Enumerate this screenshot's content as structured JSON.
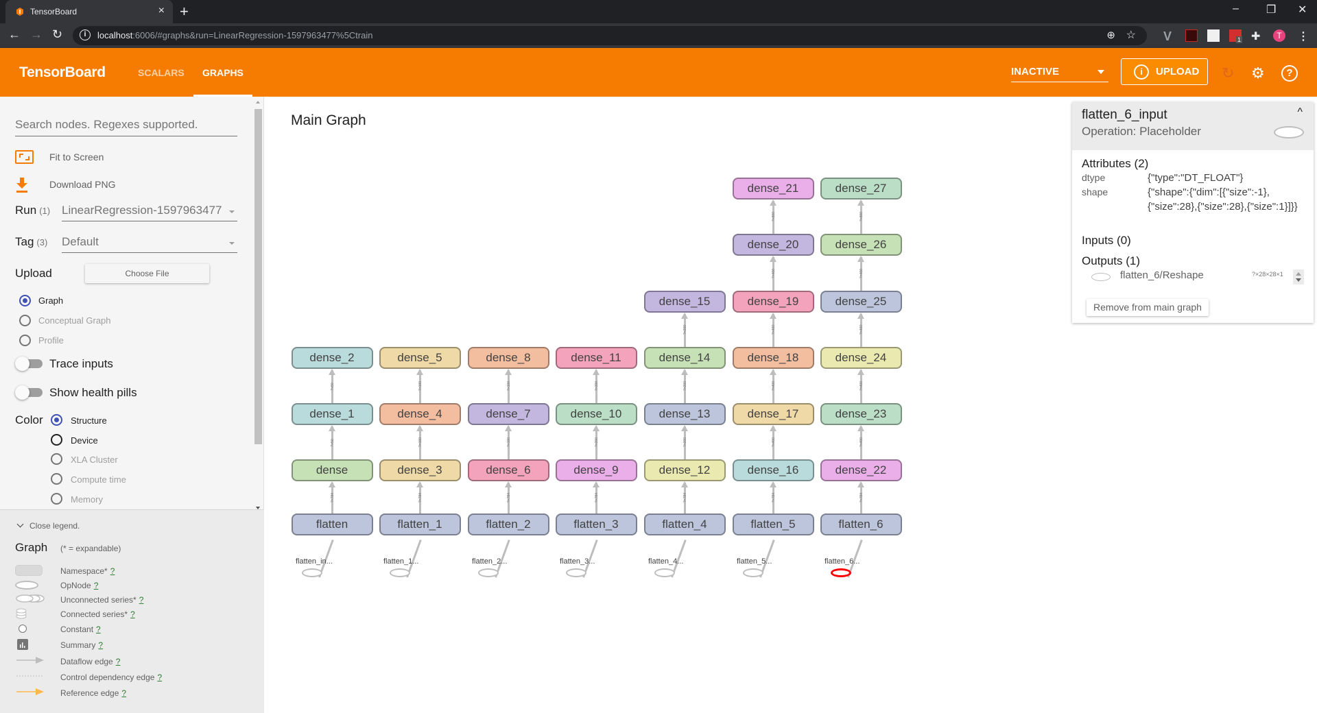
{
  "browser": {
    "tab_title": "TensorBoard",
    "tab_close": "×",
    "new_tab": "+",
    "url_host": "localhost",
    "url_rest": ":6006/#graphs&run=LinearRegression-1597963477%5Ctrain",
    "window_controls": {
      "minimize": "–",
      "restore": "❐",
      "close": "✕"
    },
    "profile_initial": "T",
    "extension_badge": "1"
  },
  "header": {
    "brand": "TensorBoard",
    "tabs": [
      {
        "label": "SCALARS",
        "active": false
      },
      {
        "label": "GRAPHS",
        "active": true
      }
    ],
    "status_select": "INACTIVE",
    "upload_label": "UPLOAD",
    "accent_color": "#f57c00"
  },
  "sidebar": {
    "search_placeholder": "Search nodes. Regexes supported.",
    "fit_to_screen": "Fit to Screen",
    "download_png": "Download PNG",
    "run_label": "Run",
    "run_count": "(1)",
    "run_value": "LinearRegression-1597963477",
    "tag_label": "Tag",
    "tag_count": "(3)",
    "tag_value": "Default",
    "upload_label": "Upload",
    "choose_file": "Choose File",
    "graph_types": [
      {
        "label": "Graph",
        "selected": true
      },
      {
        "label": "Conceptual Graph",
        "selected": false
      },
      {
        "label": "Profile",
        "selected": false
      }
    ],
    "trace_inputs": "Trace inputs",
    "trace_inputs_on": false,
    "show_health_pills": "Show health pills",
    "show_health_pills_on": false,
    "color_label": "Color",
    "color_options": [
      {
        "label": "Structure",
        "selected": true
      },
      {
        "label": "Device",
        "selected": false
      },
      {
        "label": "XLA Cluster",
        "selected": false
      },
      {
        "label": "Compute time",
        "selected": false
      },
      {
        "label": "Memory",
        "selected": false
      }
    ]
  },
  "legend": {
    "close_label": "Close legend.",
    "title": "Graph",
    "subtitle": "(* = expandable)",
    "items": [
      {
        "icon": "namespace-icon",
        "label": "Namespace*",
        "help": "?"
      },
      {
        "icon": "opnode-icon",
        "label": "OpNode",
        "help": "?"
      },
      {
        "icon": "unconnected-series-icon",
        "label": "Unconnected series*",
        "help": "?"
      },
      {
        "icon": "connected-series-icon",
        "label": "Connected series*",
        "help": "?"
      },
      {
        "icon": "constant-icon",
        "label": "Constant",
        "help": "?"
      },
      {
        "icon": "summary-icon",
        "label": "Summary",
        "help": "?"
      },
      {
        "icon": "dataflow-edge-icon",
        "label": "Dataflow edge",
        "help": "?"
      },
      {
        "icon": "control-dependency-edge-icon",
        "label": "Control dependency edge",
        "help": "?"
      },
      {
        "icon": "reference-edge-icon",
        "label": "Reference edge",
        "help": "?"
      }
    ]
  },
  "graph": {
    "title": "Main Graph",
    "columns": [
      {
        "placeholder": "flatten_in...",
        "selected": false,
        "nodes": [
          {
            "name": "flatten",
            "color": "#bcc5dc"
          },
          {
            "name": "dense",
            "color": "#c6e1b5"
          },
          {
            "name": "dense_1",
            "color": "#badbdb"
          },
          {
            "name": "dense_2",
            "color": "#badbdb"
          }
        ],
        "edge_labels": [
          "?×28×28×1",
          "?×784",
          "?×50",
          "?×50"
        ]
      },
      {
        "placeholder": "flatten_1...",
        "selected": false,
        "nodes": [
          {
            "name": "flatten_1",
            "color": "#bcc5dc"
          },
          {
            "name": "dense_3",
            "color": "#efd9a6"
          },
          {
            "name": "dense_4",
            "color": "#f3bea0"
          },
          {
            "name": "dense_5",
            "color": "#efd9a6"
          }
        ],
        "edge_labels": [
          "?×28×28×1",
          "?×784",
          "?×100",
          "?×100"
        ]
      },
      {
        "placeholder": "flatten_2...",
        "selected": false,
        "nodes": [
          {
            "name": "flatten_2",
            "color": "#bcc5dc"
          },
          {
            "name": "dense_6",
            "color": "#f4a3bd"
          },
          {
            "name": "dense_7",
            "color": "#c3b6df"
          },
          {
            "name": "dense_8",
            "color": "#f3bea0"
          }
        ],
        "edge_labels": [
          "?×28×28×1",
          "?×784",
          "?×100",
          "?×100"
        ]
      },
      {
        "placeholder": "flatten_3...",
        "selected": false,
        "nodes": [
          {
            "name": "flatten_3",
            "color": "#bcc5dc"
          },
          {
            "name": "dense_9",
            "color": "#eaaee9"
          },
          {
            "name": "dense_10",
            "color": "#bbdfc6"
          },
          {
            "name": "dense_11",
            "color": "#f4a3bd"
          }
        ],
        "edge_labels": [
          "?×28×28×1",
          "?×784",
          "?×200",
          "?×200"
        ]
      },
      {
        "placeholder": "flatten_4...",
        "selected": false,
        "nodes": [
          {
            "name": "flatten_4",
            "color": "#bcc5dc"
          },
          {
            "name": "dense_12",
            "color": "#eaeab0"
          },
          {
            "name": "dense_13",
            "color": "#bcc5dc"
          },
          {
            "name": "dense_14",
            "color": "#c6e1b5"
          },
          {
            "name": "dense_15",
            "color": "#c3b6df"
          }
        ],
        "edge_labels": [
          "?×28×28×1",
          "?×784",
          "?×200",
          "?×200",
          "?×200"
        ]
      },
      {
        "placeholder": "flatten_5...",
        "selected": false,
        "nodes": [
          {
            "name": "flatten_5",
            "color": "#bcc5dc"
          },
          {
            "name": "dense_16",
            "color": "#badbdb"
          },
          {
            "name": "dense_17",
            "color": "#efd9a6"
          },
          {
            "name": "dense_18",
            "color": "#f3bea0"
          },
          {
            "name": "dense_19",
            "color": "#f4a3bd"
          },
          {
            "name": "dense_20",
            "color": "#c3b6df"
          },
          {
            "name": "dense_21",
            "color": "#eaaee9"
          }
        ],
        "edge_labels": [
          "?×28×28×1",
          "?×784",
          "?×400",
          "?×400",
          "?×400",
          "?×400",
          "?×800"
        ]
      },
      {
        "placeholder": "flatten_6...",
        "selected": true,
        "nodes": [
          {
            "name": "flatten_6",
            "color": "#bcc5dc"
          },
          {
            "name": "dense_22",
            "color": "#eaaee9"
          },
          {
            "name": "dense_23",
            "color": "#bbdfc6"
          },
          {
            "name": "dense_24",
            "color": "#eaeab0"
          },
          {
            "name": "dense_25",
            "color": "#bcc5dc"
          },
          {
            "name": "dense_26",
            "color": "#c6e1b5"
          },
          {
            "name": "dense_27",
            "color": "#bbdfc6"
          }
        ],
        "edge_labels": [
          "?×28×28×1",
          "?×784",
          "?×400",
          "?×400",
          "?×400",
          "?×400",
          "?×800"
        ]
      }
    ]
  },
  "info_card": {
    "name": "flatten_6_input",
    "operation": "Operation: Placeholder",
    "attributes_title": "Attributes (2)",
    "attributes": [
      {
        "key": "dtype",
        "value": "{\"type\":\"DT_FLOAT\"}"
      },
      {
        "key": "shape",
        "value": "{\"shape\":{\"dim\":[{\"size\":-1},{\"size\":28},{\"size\":28},{\"size\":1}]}}"
      }
    ],
    "inputs_title": "Inputs (0)",
    "outputs_title": "Outputs (1)",
    "outputs": [
      {
        "name": "flatten_6/Reshape",
        "shape": "?×28×28×1"
      }
    ],
    "remove_button": "Remove from main graph"
  }
}
